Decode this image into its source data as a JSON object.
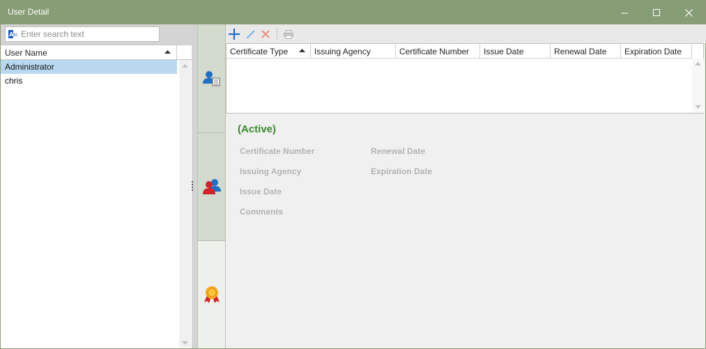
{
  "window": {
    "title": "User Detail"
  },
  "left": {
    "search_placeholder": "Enter search text",
    "column_header": "User Name",
    "users": [
      "Administrator",
      "chris"
    ],
    "selected_index": 0
  },
  "toolbar": {
    "add_icon": "plus-icon",
    "edit_icon": "pencil-icon",
    "delete_icon": "x-icon",
    "print_icon": "printer-icon"
  },
  "cert_grid": {
    "columns": [
      "Certificate Type",
      "Issuing Agency",
      "Certificate Number",
      "Issue Date",
      "Renewal Date",
      "Expiration Date"
    ]
  },
  "details": {
    "status": "(Active)",
    "labels": {
      "certificate_number": "Certificate Number",
      "issuing_agency": "Issuing Agency",
      "issue_date": "Issue Date",
      "comments": "Comments",
      "renewal_date": "Renewal Date",
      "expiration_date": "Expiration Date"
    }
  },
  "colors": {
    "titlebar": "#879d75",
    "status_green": "#3a8a2e",
    "selected_row": "#b9d8f0",
    "add_blue": "#1e6fc8",
    "delete_red": "#e05a4a"
  }
}
